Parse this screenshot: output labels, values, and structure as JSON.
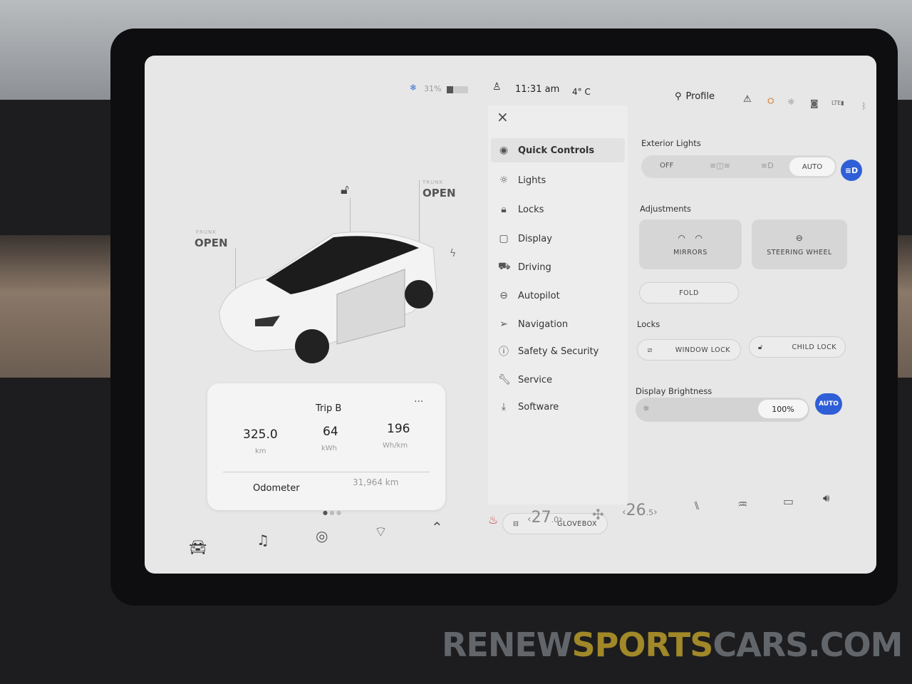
{
  "status": {
    "battery_percent": "31%",
    "time": "11:31 am",
    "temperature": "4° C",
    "profile": "Profile",
    "battery_level": 0.31
  },
  "car": {
    "frunk_label": "FRUNK",
    "frunk_status": "OPEN",
    "trunk_label": "TRUNK",
    "trunk_status": "OPEN"
  },
  "trip": {
    "title": "Trip B",
    "more": "···",
    "distance": "325.0",
    "distance_unit": "km",
    "energy": "64",
    "energy_unit": "kWh",
    "efficiency": "196",
    "efficiency_unit": "Wh/km",
    "odometer_label": "Odometer",
    "odometer_value": "31,964 km"
  },
  "menu": {
    "close": "×",
    "items": [
      {
        "label": "Quick Controls",
        "icon": "toggle-icon"
      },
      {
        "label": "Lights",
        "icon": "sun-icon"
      },
      {
        "label": "Locks",
        "icon": "lock-icon"
      },
      {
        "label": "Display",
        "icon": "display-icon"
      },
      {
        "label": "Driving",
        "icon": "car-icon"
      },
      {
        "label": "Autopilot",
        "icon": "steering-wheel-icon"
      },
      {
        "label": "Navigation",
        "icon": "navigation-icon"
      },
      {
        "label": "Safety & Security",
        "icon": "alert-icon"
      },
      {
        "label": "Service",
        "icon": "wrench-icon"
      },
      {
        "label": "Software",
        "icon": "download-icon"
      }
    ],
    "glovebox": "GLOVEBOX"
  },
  "quick": {
    "exterior_lights_title": "Exterior Lights",
    "lights_off": "OFF",
    "lights_auto": "AUTO",
    "lights_selected": "AUTO",
    "adjustments_title": "Adjustments",
    "mirrors": "MIRRORS",
    "steering_wheel": "STEERING WHEEL",
    "fold": "FOLD",
    "locks_title": "Locks",
    "window_lock": "WINDOW LOCK",
    "child_lock": "CHILD LOCK",
    "brightness_title": "Display Brightness",
    "brightness_value": "100%",
    "brightness_auto": "AUTO",
    "brightness_level": 1.0,
    "accent": "#2f5fd7"
  },
  "climate": {
    "driver_temp": "27",
    "driver_temp_dec": ".0",
    "passenger_temp": "26",
    "passenger_temp_dec": ".5",
    "prev": "‹",
    "next": "›"
  },
  "watermark": {
    "a": "RENEW",
    "b": "SPORTS",
    "c": "CARS.COM"
  }
}
